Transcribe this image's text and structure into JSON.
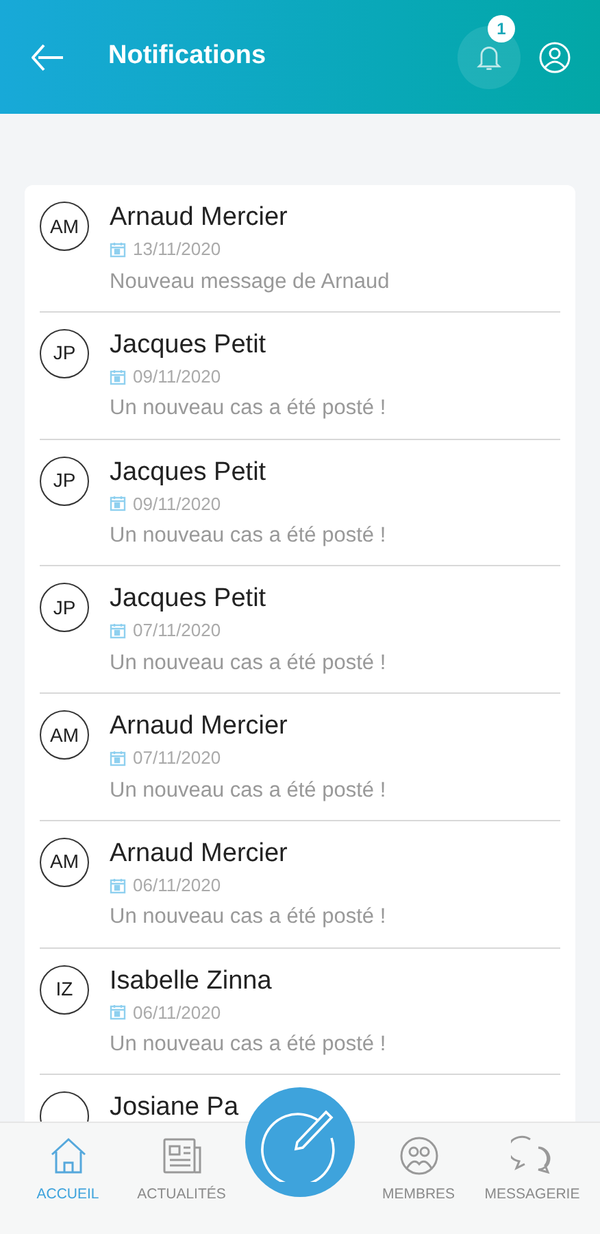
{
  "header": {
    "title": "Notifications",
    "badge": "1"
  },
  "notifications": [
    {
      "initials": "AM",
      "name": "Arnaud Mercier",
      "date": "13/11/2020",
      "message": "Nouveau message de Arnaud"
    },
    {
      "initials": "JP",
      "name": "Jacques Petit",
      "date": "09/11/2020",
      "message": "Un nouveau cas a été posté !"
    },
    {
      "initials": "JP",
      "name": "Jacques Petit",
      "date": "09/11/2020",
      "message": "Un nouveau cas a été posté !"
    },
    {
      "initials": "JP",
      "name": "Jacques Petit",
      "date": "07/11/2020",
      "message": "Un nouveau cas a été posté !"
    },
    {
      "initials": "AM",
      "name": "Arnaud Mercier",
      "date": "07/11/2020",
      "message": "Un nouveau cas a été posté !"
    },
    {
      "initials": "AM",
      "name": "Arnaud Mercier",
      "date": "06/11/2020",
      "message": "Un nouveau cas a été posté !"
    },
    {
      "initials": "IZ",
      "name": "Isabelle Zinna",
      "date": "06/11/2020",
      "message": "Un nouveau cas a été posté !"
    },
    {
      "name": "Josiane Pa"
    }
  ],
  "nav": [
    {
      "kind": "home",
      "label": "ACCUEIL",
      "selected": true
    },
    {
      "kind": "news",
      "label": "ACTUALITÉS",
      "selected": false
    },
    {
      "kind": "compose"
    },
    {
      "kind": "members",
      "label": "MEMBRES",
      "selected": false
    },
    {
      "kind": "chat",
      "label": "MESSAGERIE",
      "selected": false
    }
  ]
}
